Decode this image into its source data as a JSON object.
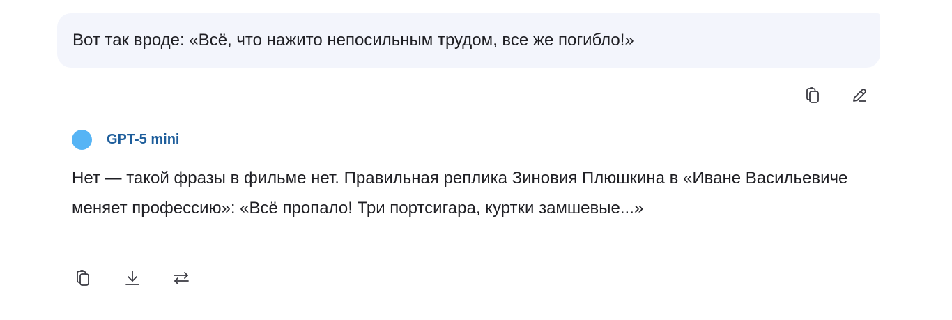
{
  "user_message": {
    "text": "Вот так вроде: «Всё, что нажито непосильным трудом, все же погибло!»",
    "actions": {
      "copy_icon": "copy-icon",
      "edit_icon": "pencil-icon"
    }
  },
  "assistant": {
    "model_name": "GPT-5 mini",
    "avatar_color": "#56b4f5",
    "name_color": "#1d5d9b",
    "response_text": "Нет — такой фразы в фильме нет. Правильная реплика Зиновия Плюшкина в «Иване Васильевиче меняет профессию»: «Всё пропало! Три портсигара, куртки замшевые...»",
    "actions": {
      "copy_icon": "copy-icon",
      "download_icon": "download-icon",
      "regenerate_icon": "regenerate-icon"
    }
  },
  "colors": {
    "user_bubble_bg": "#f3f5fc",
    "text": "#1f1f24",
    "icon": "#3a3a42"
  }
}
